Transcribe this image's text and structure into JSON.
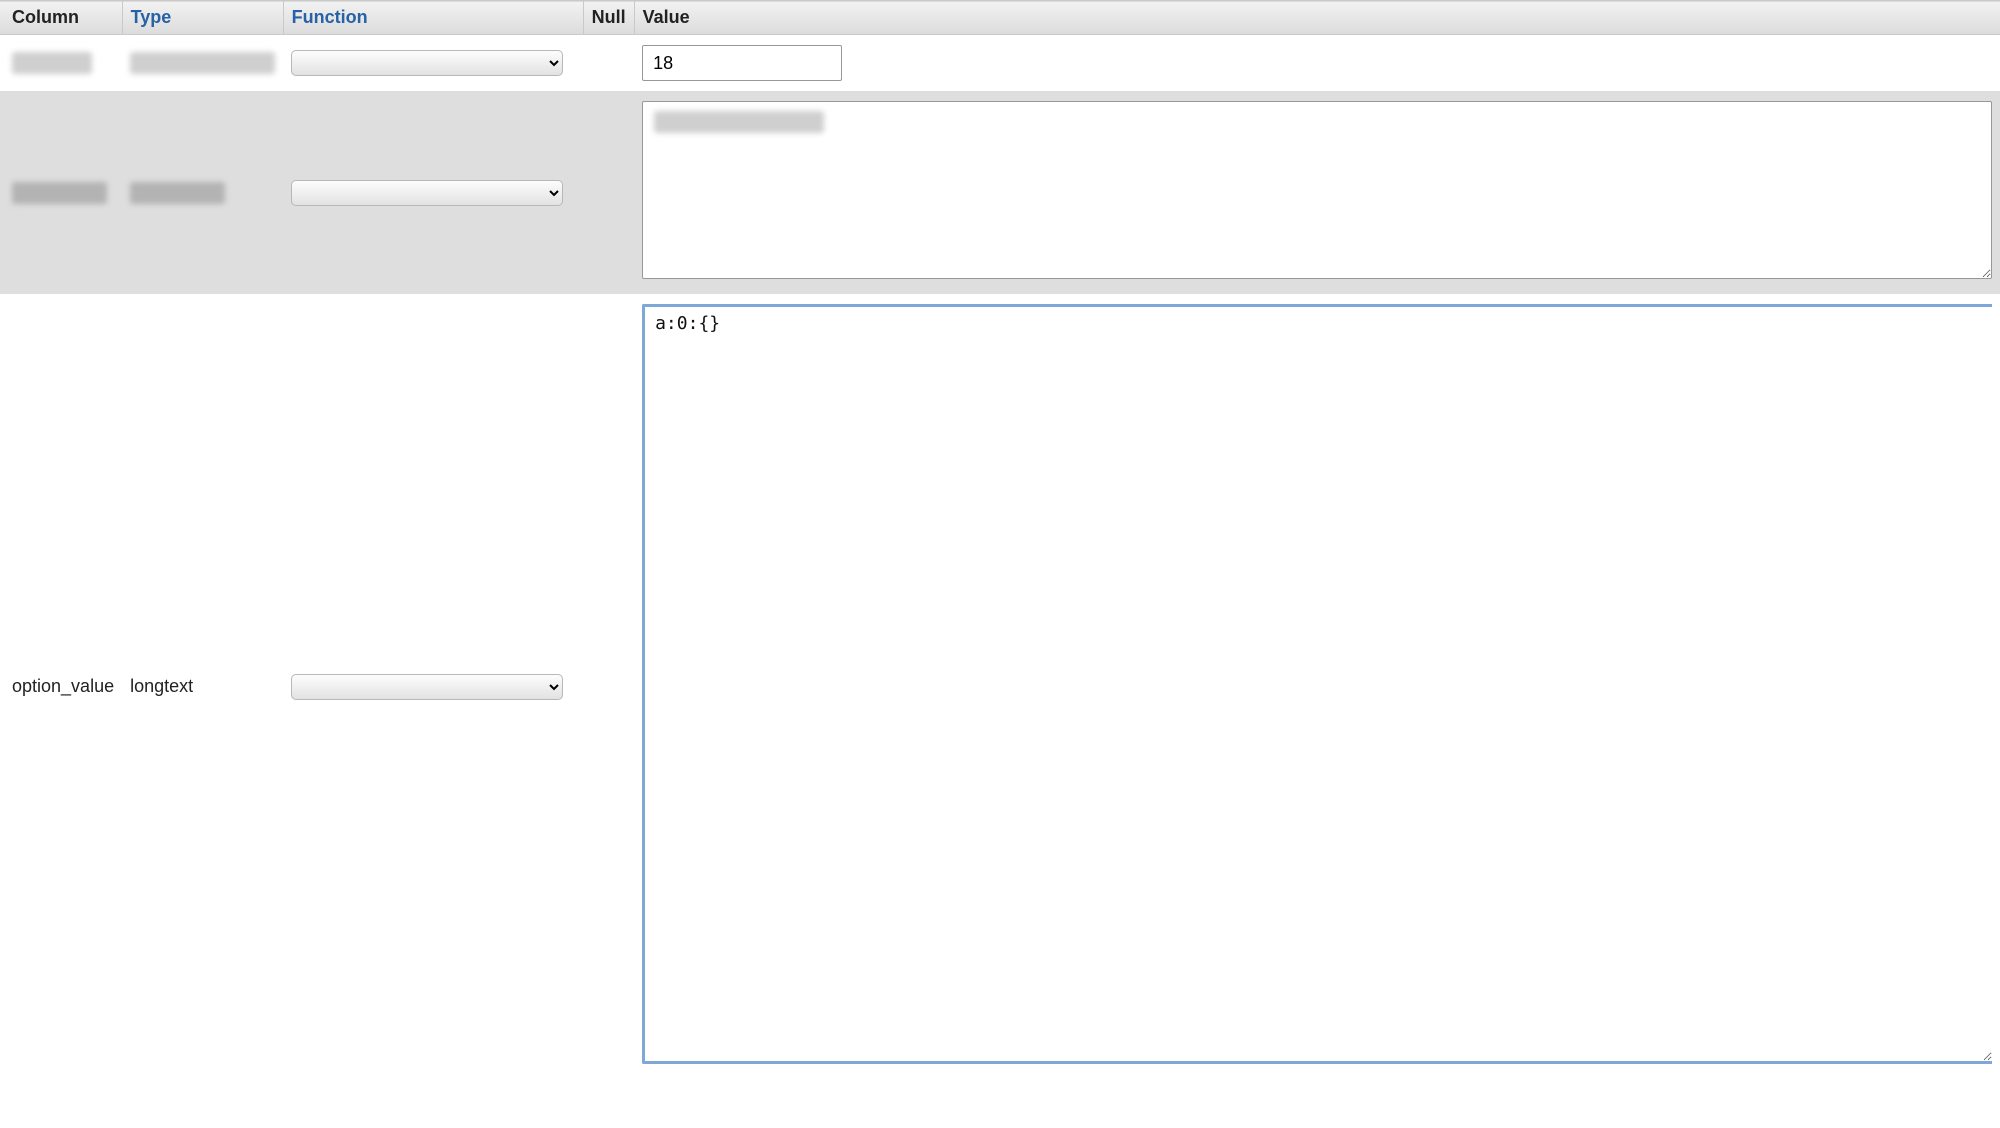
{
  "headers": {
    "column": "Column",
    "type": "Type",
    "function": "Function",
    "null": "Null",
    "value": "Value"
  },
  "rows": [
    {
      "column_obscured": true,
      "type_obscured": true,
      "function_selected": "",
      "null": "",
      "value_kind": "input",
      "value": "18"
    },
    {
      "column_obscured": true,
      "type_obscured": true,
      "function_selected": "",
      "null": "",
      "value_kind": "textarea_mid",
      "value_obscured": true,
      "value": ""
    },
    {
      "column": "option_value",
      "type": "longtext",
      "function_selected": "",
      "null": "",
      "value_kind": "textarea_large",
      "value": "a:0:{}"
    }
  ]
}
